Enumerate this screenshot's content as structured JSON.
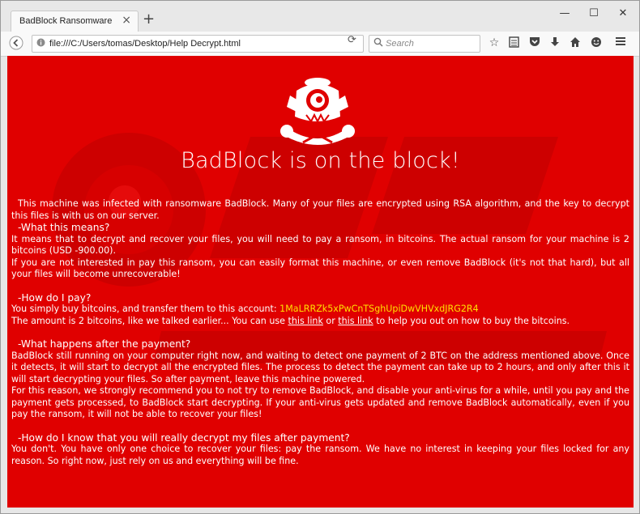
{
  "tab": {
    "title": "BadBlock Ransomware",
    "close": "×",
    "new_tab": "+"
  },
  "window_controls": {
    "minimize": "—",
    "maximize": "☐",
    "close": "✕"
  },
  "nav": {
    "url": "file:///C:/Users/tomas/Desktop/Help Decrypt.html",
    "search_placeholder": "Search"
  },
  "icons": [
    "back-icon",
    "page-info-icon",
    "reload-icon",
    "search-icon",
    "bookmark-star-icon",
    "reading-list-icon",
    "pocket-icon",
    "download-icon",
    "home-icon",
    "smiley-icon",
    "menu-icon"
  ],
  "colors": {
    "background": "#e00000",
    "address": "#ffe000",
    "text": "#ffffff"
  },
  "page": {
    "headline": "BadBlock is on the block!",
    "intro": "This machine was infected with ransomware BadBlock. Many of your files are encrypted using RSA algorithm, and the key to decrypt this files is with us on our server.",
    "q1": "-What this means?",
    "a1_1": "It means that to decrypt and recover your files, you will need to pay a ransom, in bitcoins. The actual ransom for your machine is 2 bitcoins (USD -900.00).",
    "a1_2": "If you are not interested in pay this ransom, you can easily format this machine, or even remove BadBlock (it's not that hard), but all your files will become unrecoverable!",
    "q2": "-How do I pay?",
    "a2_1_prefix": "You simply buy bitcoins, and transfer them to this account: ",
    "btc_address": "1MaLRRZk5xPwCnTSghUpiDwVHVxdJRG2R4",
    "a2_2_prefix": "The amount is 2 bitcoins, like we talked earlier... You can use ",
    "link1": "this link",
    "a2_2_mid": " or ",
    "link2": "this link",
    "a2_2_suffix": " to help you out on how to buy the bitcoins.",
    "q3": "-What happens after the payment?",
    "a3_1": "BadBlock still running on your computer right now, and waiting to detect one payment of 2 BTC on the address mentioned above. Once it detects, it will start to decrypt all the encrypted files. The process to detect the payment can take up to 2 hours, and only after this it will start decrypting your files. So after payment, leave this machine powered.",
    "a3_2": "For this reason, we strongly recommend you to not try to remove BadBlock, and disable your anti-virus for a while, until you pay and the payment gets processed, to BadBlock start decrypting. If your anti-virus gets updated and remove BadBlock automatically, even if you pay the ransom, it will not be able to recover your files!",
    "q4": "-How do I know that you will really decrypt my files after payment?",
    "a4": "You don't. You have only one choice to recover your files: pay the ransom. We have no interest in keeping your files locked for any reason. So right now, just rely on us and everything will be fine."
  }
}
